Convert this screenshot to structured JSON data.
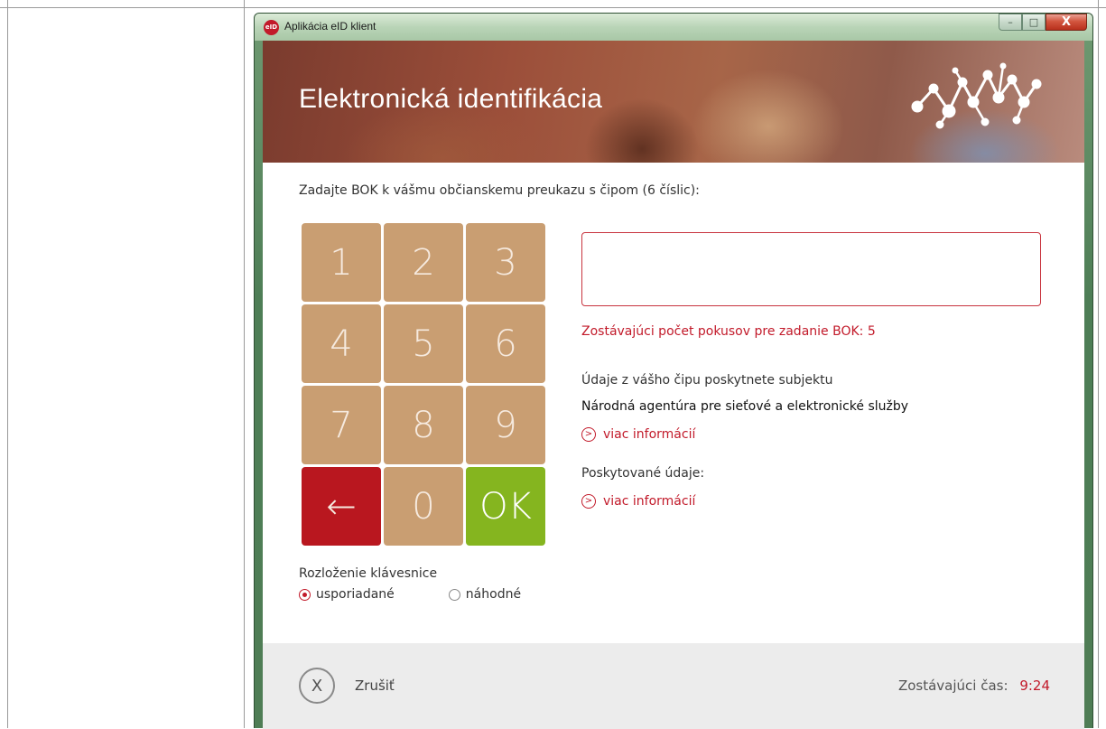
{
  "window": {
    "title": "Aplikácia eID klient",
    "icon_text": "eID",
    "controls": {
      "minimize": "–",
      "maximize": "□",
      "close": "X"
    }
  },
  "banner": {
    "title": "Elektronická identifikácia"
  },
  "prompt": "Zadajte BOK k vášmu občianskemu preukazu s čipom (6 číslic):",
  "keypad": {
    "keys": [
      "1",
      "2",
      "3",
      "4",
      "5",
      "6",
      "7",
      "8",
      "9"
    ],
    "backspace": "←",
    "zero": "0",
    "ok": "OK"
  },
  "keyboard_layout": {
    "label": "Rozloženie klávesnice",
    "options": [
      "usporiadané",
      "náhodné"
    ],
    "selected": "usporiadané"
  },
  "pin_field": {
    "value": ""
  },
  "attempts_text": "Zostávajúci počet pokusov pre zadanie BOK: 5",
  "consent": {
    "text": "Údaje z vášho čipu poskytnete subjektu",
    "subject": "Národná agentúra pre sieťové a elektronické služby",
    "more_info": "viac informácií"
  },
  "provided": {
    "label": "Poskytované údaje:",
    "more_info": "viac informácií"
  },
  "footer": {
    "cancel_icon": "X",
    "cancel_label": "Zrušiť",
    "time_label": "Zostávajúci čas:",
    "time_value": "9:24"
  },
  "colors": {
    "accent": "#c21a2a",
    "key": "#c99e72",
    "backspace": "#b9171f",
    "ok": "#85b51f",
    "footer": "#ececec"
  }
}
